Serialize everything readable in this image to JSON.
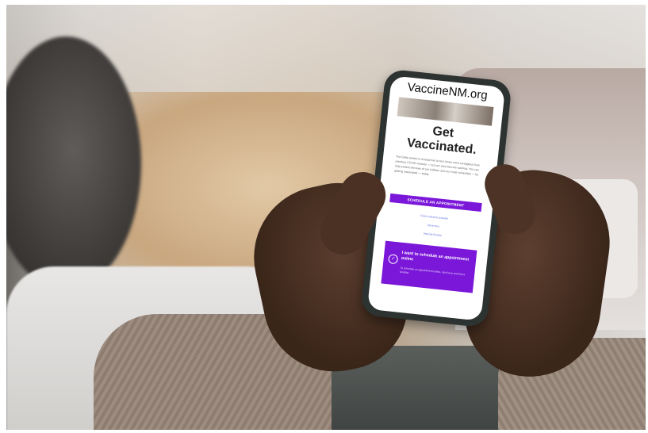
{
  "screen": {
    "site_url": "VaccineNM.org",
    "headline_line1": "Get",
    "headline_line2": "Vaccinated.",
    "body_text": "The Delta variant is at least two to four times more contagious than previous COVID variants — but our vaccines are working. You can help protect the lives of our children and our most vulnerable — by getting vaccinated — today.",
    "cta_button": "SCHEDULE AN APPOINTMENT",
    "links": [
      "Find a Vaccine provider",
      "Drive-thru",
      "Vaccine Events"
    ],
    "card": {
      "icon": "calendar-check-icon",
      "title": "I want to schedule an appointment online",
      "description": "To schedule an appointment online, click here and find a location."
    }
  },
  "colors": {
    "brand_purple": "#7b17d9",
    "link_blue": "#5b6de0"
  }
}
